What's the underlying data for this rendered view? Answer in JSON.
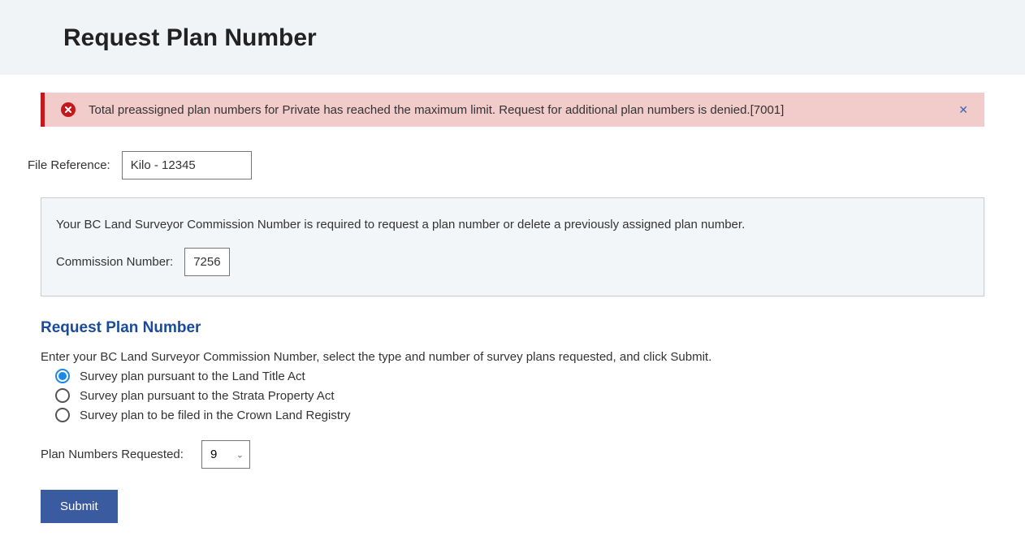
{
  "header": {
    "title": "Request Plan Number"
  },
  "alert": {
    "message": "Total preassigned plan numbers for Private has reached the maximum limit. Request for additional plan numbers is denied.[7001]"
  },
  "file_reference": {
    "label": "File Reference:",
    "value": "Kilo - 12345"
  },
  "commission_panel": {
    "info": "Your BC Land Surveyor Commission Number is required to request a plan number or delete a previously assigned plan number.",
    "label": "Commission Number:",
    "value": "7256"
  },
  "section": {
    "heading": "Request Plan Number",
    "instruction": "Enter your BC Land Surveyor Commission Number, select the type and number of survey plans requested, and click Submit."
  },
  "radios": {
    "option1": "Survey plan pursuant to the Land Title Act",
    "option2": "Survey plan pursuant to the Strata Property Act",
    "option3": "Survey plan to be filed in the Crown Land Registry"
  },
  "plan_numbers": {
    "label": "Plan Numbers Requested:",
    "value": "9"
  },
  "submit": {
    "label": "Submit"
  }
}
